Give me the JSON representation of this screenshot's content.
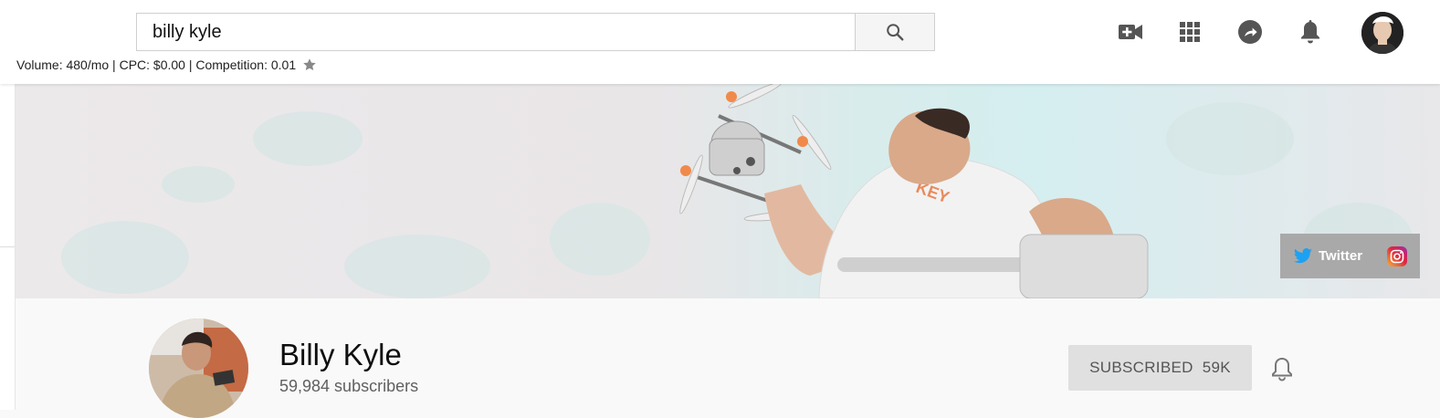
{
  "search": {
    "value": "billy kyle",
    "button_icon": "search-icon"
  },
  "keyword_stats": {
    "text": "Volume: 480/mo | CPC: $0.00 | Competition: 0.01",
    "icon": "star-icon"
  },
  "toolbar": {
    "icons": [
      "video-camera-add-icon",
      "apps-grid-icon",
      "share-icon",
      "notifications-bell-icon"
    ],
    "avatar": "user-avatar"
  },
  "banner": {
    "links": {
      "twitter_label": "Twitter",
      "instagram_icon": "instagram-icon"
    }
  },
  "channel": {
    "name": "Billy Kyle",
    "subscribers": "59,984 subscribers",
    "subscribe_label": "SUBSCRIBED",
    "subscribe_count": "59K",
    "bell_icon": "notification-bell-icon"
  },
  "colors": {
    "accent_twitter": "#1da1f2",
    "links_bg": "#a9a9a9",
    "sub_button_bg": "#e0e0e0"
  }
}
